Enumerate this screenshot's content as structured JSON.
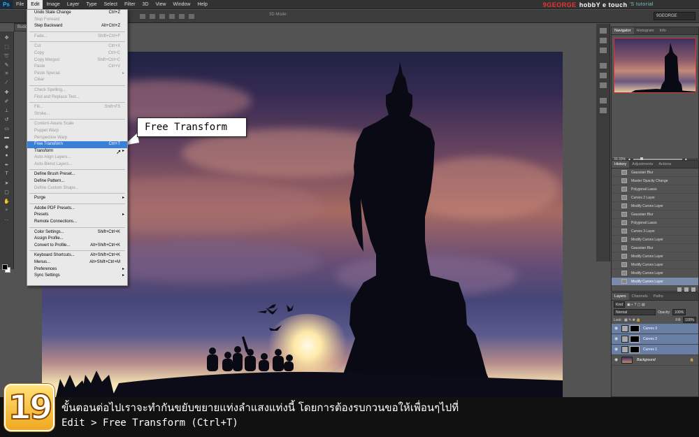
{
  "menubar": {
    "logo": "Ps",
    "items": [
      "File",
      "Edit",
      "Image",
      "Layer",
      "Type",
      "Select",
      "Filter",
      "3D",
      "View",
      "Window",
      "Help"
    ],
    "active_index": 1,
    "brand": {
      "part1": "9GEORGE",
      "part2": "hobbY e touch",
      "part3": "'S tutorial"
    },
    "brand_sub": "9GEORGE"
  },
  "options_bar": {
    "mode_label": "3D Mode:",
    "workspace_value": "9GEORGE"
  },
  "document_tab": "Budd",
  "edit_menu": {
    "items": [
      {
        "label": "Undo State Change",
        "shortcut": "Ctrl+Z",
        "disabled": false
      },
      {
        "label": "Step Forward",
        "shortcut": "",
        "disabled": true
      },
      {
        "label": "Step Backward",
        "shortcut": "Alt+Ctrl+Z",
        "disabled": false
      },
      {
        "sep": true
      },
      {
        "label": "Fade...",
        "shortcut": "Shift+Ctrl+F",
        "disabled": true
      },
      {
        "sep": true
      },
      {
        "label": "Cut",
        "shortcut": "Ctrl+X",
        "disabled": true
      },
      {
        "label": "Copy",
        "shortcut": "Ctrl+C",
        "disabled": true
      },
      {
        "label": "Copy Merged",
        "shortcut": "Shift+Ctrl+C",
        "disabled": true
      },
      {
        "label": "Paste",
        "shortcut": "Ctrl+V",
        "disabled": true
      },
      {
        "label": "Paste Special",
        "shortcut": "",
        "disabled": true,
        "submenu": true
      },
      {
        "label": "Clear",
        "shortcut": "",
        "disabled": true
      },
      {
        "sep": true
      },
      {
        "label": "Check Spelling...",
        "shortcut": "",
        "disabled": true
      },
      {
        "label": "Find and Replace Text...",
        "shortcut": "",
        "disabled": true
      },
      {
        "sep": true
      },
      {
        "label": "Fill...",
        "shortcut": "Shift+F5",
        "disabled": true
      },
      {
        "label": "Stroke...",
        "shortcut": "",
        "disabled": true
      },
      {
        "sep": true
      },
      {
        "label": "Content-Aware Scale",
        "shortcut": "",
        "disabled": true
      },
      {
        "label": "Puppet Warp",
        "shortcut": "",
        "disabled": true
      },
      {
        "label": "Perspective Warp",
        "shortcut": "",
        "disabled": true
      },
      {
        "label": "Free Transform",
        "shortcut": "Ctrl+T",
        "disabled": false,
        "highlight": true
      },
      {
        "label": "Transform",
        "shortcut": "",
        "disabled": false,
        "submenu": true
      },
      {
        "label": "Auto-Align Layers...",
        "shortcut": "",
        "disabled": true
      },
      {
        "label": "Auto-Blend Layers...",
        "shortcut": "",
        "disabled": true
      },
      {
        "sep": true
      },
      {
        "label": "Define Brush Preset...",
        "shortcut": "",
        "disabled": false
      },
      {
        "label": "Define Pattern...",
        "shortcut": "",
        "disabled": false
      },
      {
        "label": "Define Custom Shape...",
        "shortcut": "",
        "disabled": true
      },
      {
        "sep": true
      },
      {
        "label": "Purge",
        "shortcut": "",
        "disabled": false,
        "submenu": true
      },
      {
        "sep": true
      },
      {
        "label": "Adobe PDF Presets...",
        "shortcut": "",
        "disabled": false
      },
      {
        "label": "Presets",
        "shortcut": "",
        "disabled": false,
        "submenu": true
      },
      {
        "label": "Remote Connections...",
        "shortcut": "",
        "disabled": false
      },
      {
        "sep": true
      },
      {
        "label": "Color Settings...",
        "shortcut": "Shift+Ctrl+K",
        "disabled": false
      },
      {
        "label": "Assign Profile...",
        "shortcut": "",
        "disabled": false
      },
      {
        "label": "Convert to Profile...",
        "shortcut": "Alt+Shift+Ctrl+K",
        "disabled": false
      },
      {
        "sep": true
      },
      {
        "label": "Keyboard Shortcuts...",
        "shortcut": "Alt+Shift+Ctrl+K",
        "disabled": false
      },
      {
        "label": "Menus...",
        "shortcut": "Alt+Shift+Ctrl+M",
        "disabled": false
      },
      {
        "label": "Preferences",
        "shortcut": "",
        "disabled": false,
        "submenu": true
      },
      {
        "label": "Sync Settings",
        "shortcut": "",
        "disabled": false,
        "submenu": true
      }
    ]
  },
  "callout": {
    "text": "Free Transform"
  },
  "navigator": {
    "tabs": [
      "Navigator",
      "Histogram",
      "Info"
    ],
    "zoom": "33.33%"
  },
  "history": {
    "tabs": [
      "History",
      "Adjustments",
      "Actions"
    ],
    "items": [
      "Gaussian Blur",
      "Master Opacity Change",
      "Polygonal Lasso",
      "Curves 2 Layer",
      "Modify Curves Layer",
      "Gaussian Blur",
      "Polygonal Lasso",
      "Curves 3 Layer",
      "Modify Curves Layer",
      "Gaussian Blur",
      "Modify Curves Layer",
      "Modify Curves Layer",
      "Modify Curves Layer",
      "Modify Curves Layer"
    ],
    "selected_index": 13
  },
  "layers": {
    "tabs": [
      "Layers",
      "Channels",
      "Paths"
    ],
    "kind_label": "Kind",
    "blend_mode": "Normal",
    "opacity_label": "Opacity:",
    "opacity_value": "100%",
    "lock_label": "Lock:",
    "fill_label": "Fill:",
    "fill_value": "100%",
    "items": [
      {
        "name": "Curves 3",
        "selected": true,
        "type": "adjust"
      },
      {
        "name": "Curves 2",
        "selected": true,
        "type": "adjust"
      },
      {
        "name": "Curves 1",
        "selected": true,
        "type": "adjust"
      },
      {
        "name": "Background",
        "selected": false,
        "type": "background"
      }
    ]
  },
  "caption": {
    "step_number": "19",
    "line1": "ขั้นตอนต่อไปเราจะทำกันขยับขยายแท่งลำแสงแท่งนี้ โดยการต้องรบกวนขอให้เพื่อนๆไปที่",
    "line2": "Edit > Free Transform (Ctrl+T)"
  },
  "colors": {
    "highlight": "#3b7fd6",
    "accent_badge": "#f0a820",
    "panel_bg": "#535353"
  }
}
